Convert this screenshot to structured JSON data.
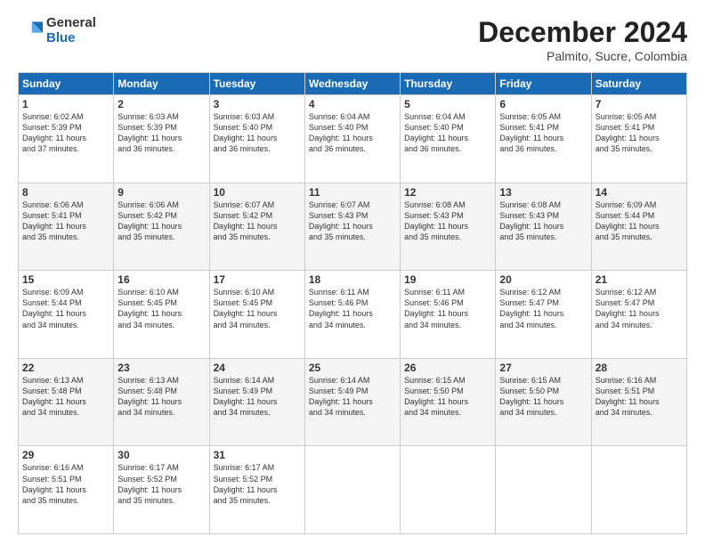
{
  "logo": {
    "general": "General",
    "blue": "Blue"
  },
  "title": "December 2024",
  "subtitle": "Palmito, Sucre, Colombia",
  "days_header": [
    "Sunday",
    "Monday",
    "Tuesday",
    "Wednesday",
    "Thursday",
    "Friday",
    "Saturday"
  ],
  "weeks": [
    [
      {
        "day": "1",
        "sunrise": "6:02 AM",
        "sunset": "5:39 PM",
        "daylight": "11 hours and 37 minutes."
      },
      {
        "day": "2",
        "sunrise": "6:03 AM",
        "sunset": "5:39 PM",
        "daylight": "11 hours and 36 minutes."
      },
      {
        "day": "3",
        "sunrise": "6:03 AM",
        "sunset": "5:40 PM",
        "daylight": "11 hours and 36 minutes."
      },
      {
        "day": "4",
        "sunrise": "6:04 AM",
        "sunset": "5:40 PM",
        "daylight": "11 hours and 36 minutes."
      },
      {
        "day": "5",
        "sunrise": "6:04 AM",
        "sunset": "5:40 PM",
        "daylight": "11 hours and 36 minutes."
      },
      {
        "day": "6",
        "sunrise": "6:05 AM",
        "sunset": "5:41 PM",
        "daylight": "11 hours and 36 minutes."
      },
      {
        "day": "7",
        "sunrise": "6:05 AM",
        "sunset": "5:41 PM",
        "daylight": "11 hours and 35 minutes."
      }
    ],
    [
      {
        "day": "8",
        "sunrise": "6:06 AM",
        "sunset": "5:41 PM",
        "daylight": "11 hours and 35 minutes."
      },
      {
        "day": "9",
        "sunrise": "6:06 AM",
        "sunset": "5:42 PM",
        "daylight": "11 hours and 35 minutes."
      },
      {
        "day": "10",
        "sunrise": "6:07 AM",
        "sunset": "5:42 PM",
        "daylight": "11 hours and 35 minutes."
      },
      {
        "day": "11",
        "sunrise": "6:07 AM",
        "sunset": "5:43 PM",
        "daylight": "11 hours and 35 minutes."
      },
      {
        "day": "12",
        "sunrise": "6:08 AM",
        "sunset": "5:43 PM",
        "daylight": "11 hours and 35 minutes."
      },
      {
        "day": "13",
        "sunrise": "6:08 AM",
        "sunset": "5:43 PM",
        "daylight": "11 hours and 35 minutes."
      },
      {
        "day": "14",
        "sunrise": "6:09 AM",
        "sunset": "5:44 PM",
        "daylight": "11 hours and 35 minutes."
      }
    ],
    [
      {
        "day": "15",
        "sunrise": "6:09 AM",
        "sunset": "5:44 PM",
        "daylight": "11 hours and 34 minutes."
      },
      {
        "day": "16",
        "sunrise": "6:10 AM",
        "sunset": "5:45 PM",
        "daylight": "11 hours and 34 minutes."
      },
      {
        "day": "17",
        "sunrise": "6:10 AM",
        "sunset": "5:45 PM",
        "daylight": "11 hours and 34 minutes."
      },
      {
        "day": "18",
        "sunrise": "6:11 AM",
        "sunset": "5:46 PM",
        "daylight": "11 hours and 34 minutes."
      },
      {
        "day": "19",
        "sunrise": "6:11 AM",
        "sunset": "5:46 PM",
        "daylight": "11 hours and 34 minutes."
      },
      {
        "day": "20",
        "sunrise": "6:12 AM",
        "sunset": "5:47 PM",
        "daylight": "11 hours and 34 minutes."
      },
      {
        "day": "21",
        "sunrise": "6:12 AM",
        "sunset": "5:47 PM",
        "daylight": "11 hours and 34 minutes."
      }
    ],
    [
      {
        "day": "22",
        "sunrise": "6:13 AM",
        "sunset": "5:48 PM",
        "daylight": "11 hours and 34 minutes."
      },
      {
        "day": "23",
        "sunrise": "6:13 AM",
        "sunset": "5:48 PM",
        "daylight": "11 hours and 34 minutes."
      },
      {
        "day": "24",
        "sunrise": "6:14 AM",
        "sunset": "5:49 PM",
        "daylight": "11 hours and 34 minutes."
      },
      {
        "day": "25",
        "sunrise": "6:14 AM",
        "sunset": "5:49 PM",
        "daylight": "11 hours and 34 minutes."
      },
      {
        "day": "26",
        "sunrise": "6:15 AM",
        "sunset": "5:50 PM",
        "daylight": "11 hours and 34 minutes."
      },
      {
        "day": "27",
        "sunrise": "6:15 AM",
        "sunset": "5:50 PM",
        "daylight": "11 hours and 34 minutes."
      },
      {
        "day": "28",
        "sunrise": "6:16 AM",
        "sunset": "5:51 PM",
        "daylight": "11 hours and 34 minutes."
      }
    ],
    [
      {
        "day": "29",
        "sunrise": "6:16 AM",
        "sunset": "5:51 PM",
        "daylight": "11 hours and 35 minutes."
      },
      {
        "day": "30",
        "sunrise": "6:17 AM",
        "sunset": "5:52 PM",
        "daylight": "11 hours and 35 minutes."
      },
      {
        "day": "31",
        "sunrise": "6:17 AM",
        "sunset": "5:52 PM",
        "daylight": "11 hours and 35 minutes."
      },
      null,
      null,
      null,
      null
    ]
  ]
}
